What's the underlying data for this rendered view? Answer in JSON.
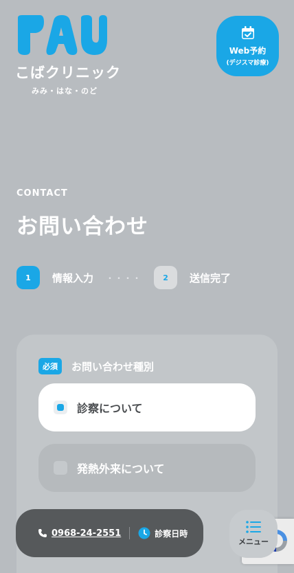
{
  "header": {
    "logo_name": "こばクリニック",
    "logo_sub": "みみ・はな・のど",
    "web_button": {
      "line1": "Web予約",
      "line2": "(デジスマ診療)"
    }
  },
  "page": {
    "eyebrow": "CONTACT",
    "title": "お問い合わせ"
  },
  "steps": [
    {
      "number": "1",
      "label": "情報入力",
      "active": true
    },
    {
      "number": "2",
      "label": "送信完了",
      "active": false
    }
  ],
  "steps_separator": "・・・・",
  "form": {
    "required_badge": "必須",
    "field_label": "お問い合わせ種別",
    "options": [
      {
        "label": "診察について",
        "selected": true
      },
      {
        "label": "発熱外来について",
        "selected": false
      }
    ]
  },
  "bottom_bar": {
    "phone": "0968-24-2551",
    "hours": "診察日時"
  },
  "menu_button": {
    "label": "メニュー"
  },
  "colors": {
    "accent": "#1aa7e6",
    "background": "#b8bcc0",
    "bar": "#56595b"
  }
}
